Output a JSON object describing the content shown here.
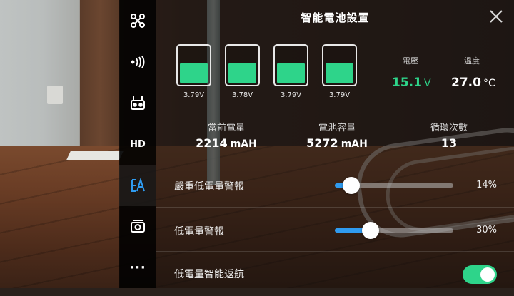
{
  "sidebar": {
    "items": [
      {
        "icon": "drone-icon"
      },
      {
        "icon": "signal-icon"
      },
      {
        "icon": "remote-controller-icon"
      },
      {
        "icon": "hd-icon",
        "label": "HD"
      },
      {
        "icon": "battery-settings-icon",
        "active": true
      },
      {
        "icon": "camera-settings-icon"
      },
      {
        "icon": "more-icon",
        "label": "···"
      }
    ]
  },
  "panel": {
    "title": "智能電池設置",
    "close_icon": "close-icon"
  },
  "cells": [
    {
      "voltage": "3.79V",
      "level": 0.55
    },
    {
      "voltage": "3.78V",
      "level": 0.55
    },
    {
      "voltage": "3.79V",
      "level": 0.55
    },
    {
      "voltage": "3.79V",
      "level": 0.55
    }
  ],
  "stats": {
    "voltage_label": "電壓",
    "voltage_value": "15.1",
    "voltage_unit": "V",
    "temp_label": "溫度",
    "temp_value": "27.0",
    "temp_unit": "°C"
  },
  "info": {
    "current_label": "當前電量",
    "current_value": "2214",
    "current_unit": "mAH",
    "capacity_label": "電池容量",
    "capacity_value": "5272",
    "capacity_unit": "mAH",
    "cycles_label": "循環次數",
    "cycles_value": "13"
  },
  "settings": {
    "critical_label": "嚴重低電量警報",
    "critical_value": "14%",
    "critical_fraction": 0.14,
    "low_label": "低電量警報",
    "low_value": "30%",
    "low_fraction": 0.3,
    "rth_label": "低電量智能返航",
    "rth_enabled": true
  },
  "colors": {
    "accent_green": "#2ed48a",
    "slider_blue": "#2f9bf0"
  }
}
